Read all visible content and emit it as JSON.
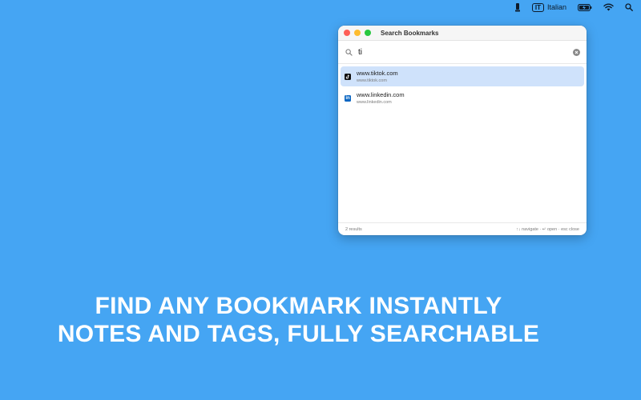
{
  "menubar": {
    "language_code": "IT",
    "language_name": "Italian",
    "icons": [
      "app-icon",
      "battery-icon",
      "wifi-icon",
      "search-icon"
    ]
  },
  "window": {
    "title": "Search Bookmarks",
    "search": {
      "value": "ti",
      "placeholder": ""
    },
    "results": [
      {
        "title": "www.tiktok.com",
        "url": "www.tiktok.com",
        "favicon": "tiktok-icon",
        "selected": true
      },
      {
        "title": "www.linkedin.com",
        "url": "www.linkedin.com",
        "favicon": "linkedin-icon",
        "selected": false
      }
    ],
    "footer": {
      "count": "2 results",
      "hints": "↑↓ navigate · ↵ open · esc close"
    }
  },
  "headline": {
    "line1": "FIND ANY BOOKMARK INSTANTLY",
    "line2": "NOTES AND TAGS, FULLY SEARCHABLE"
  },
  "colors": {
    "background": "#45a5f3",
    "selected_row": "#cfe2fb",
    "traffic_red": "#fe5f57",
    "traffic_yellow": "#febc2e",
    "traffic_green": "#28c840"
  }
}
